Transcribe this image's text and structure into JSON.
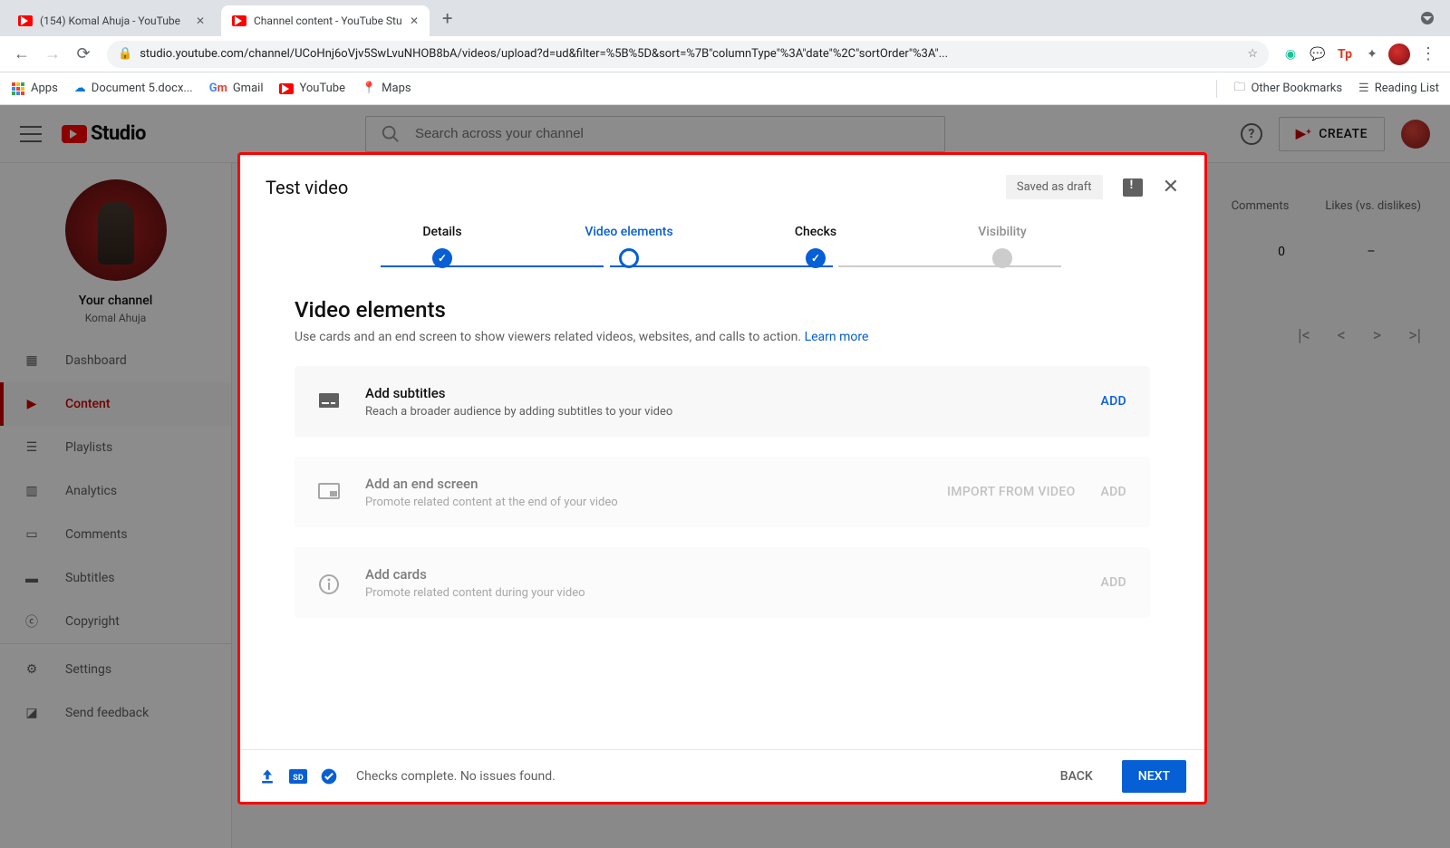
{
  "browser": {
    "tabs": [
      {
        "title": "(154) Komal Ahuja - YouTube",
        "active": false
      },
      {
        "title": "Channel content - YouTube Stu",
        "active": true
      }
    ],
    "url": "studio.youtube.com/channel/UCoHnj6oVjv5SwLvuNHOB8bA/videos/upload?d=ud&filter=%5B%5D&sort=%7B\"columnType\"%3A\"date\"%2C\"sortOrder\"%3A\"...",
    "bookmarks": {
      "apps": "Apps",
      "items": [
        "Document 5.docx...",
        "Gmail",
        "YouTube",
        "Maps"
      ],
      "other": "Other Bookmarks",
      "reading": "Reading List"
    }
  },
  "studio": {
    "logo": "Studio",
    "search_placeholder": "Search across your channel",
    "create": "CREATE",
    "channel": {
      "title": "Your channel",
      "name": "Komal Ahuja"
    },
    "nav": {
      "dashboard": "Dashboard",
      "content": "Content",
      "playlists": "Playlists",
      "analytics": "Analytics",
      "comments": "Comments",
      "subtitles": "Subtitles",
      "copyright": "Copyright",
      "settings": "Settings",
      "feedback": "Send feedback"
    },
    "table": {
      "col_comments": "Comments",
      "col_likes": "Likes (vs. dislikes)",
      "row": {
        "comments": "0",
        "likes": "–"
      }
    }
  },
  "dialog": {
    "title": "Test video",
    "saved": "Saved as draft",
    "steps": {
      "details": "Details",
      "elements": "Video elements",
      "checks": "Checks",
      "visibility": "Visibility"
    },
    "section": {
      "heading": "Video elements",
      "desc": "Use cards and an end screen to show viewers related videos, websites, and calls to action. ",
      "learn": "Learn more"
    },
    "cards": {
      "subtitles": {
        "title": "Add subtitles",
        "sub": "Reach a broader audience by adding subtitles to your video",
        "action": "ADD"
      },
      "endscreen": {
        "title": "Add an end screen",
        "sub": "Promote related content at the end of your video",
        "import": "IMPORT FROM VIDEO",
        "action": "ADD"
      },
      "infocards": {
        "title": "Add cards",
        "sub": "Promote related content during your video",
        "action": "ADD"
      }
    },
    "footer": {
      "status": "Checks complete. No issues found.",
      "back": "BACK",
      "next": "NEXT"
    }
  }
}
